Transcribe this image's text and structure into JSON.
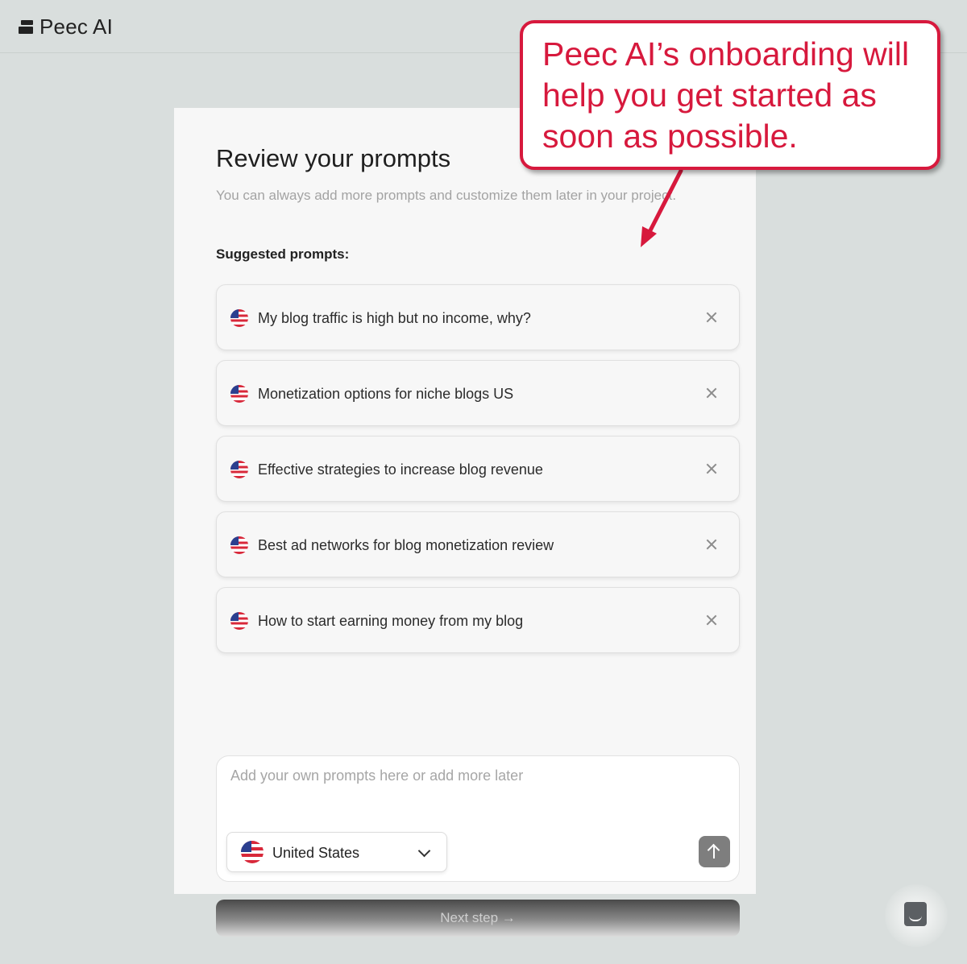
{
  "app": {
    "logo_text": "Peec AI"
  },
  "page": {
    "title": "Review your prompts",
    "subtitle": "You can always add more prompts and customize them later in your project.",
    "suggested_label": "Suggested prompts:"
  },
  "prompts": [
    {
      "text": "My blog traffic is high but no income, why?",
      "country_icon": "us-flag-icon"
    },
    {
      "text": "Monetization options for niche blogs US",
      "country_icon": "us-flag-icon"
    },
    {
      "text": "Effective strategies to increase blog revenue",
      "country_icon": "us-flag-icon"
    },
    {
      "text": "Best ad networks for blog monetization review",
      "country_icon": "us-flag-icon"
    },
    {
      "text": "How to start earning money from my blog",
      "country_icon": "us-flag-icon"
    }
  ],
  "composer": {
    "placeholder": "Add your own prompts here or add more later",
    "country": "United States"
  },
  "next_button": "Next step →",
  "annotation": {
    "text": "Peec AI’s onboarding will help you get started as soon as possible.",
    "color": "#d7193d"
  }
}
